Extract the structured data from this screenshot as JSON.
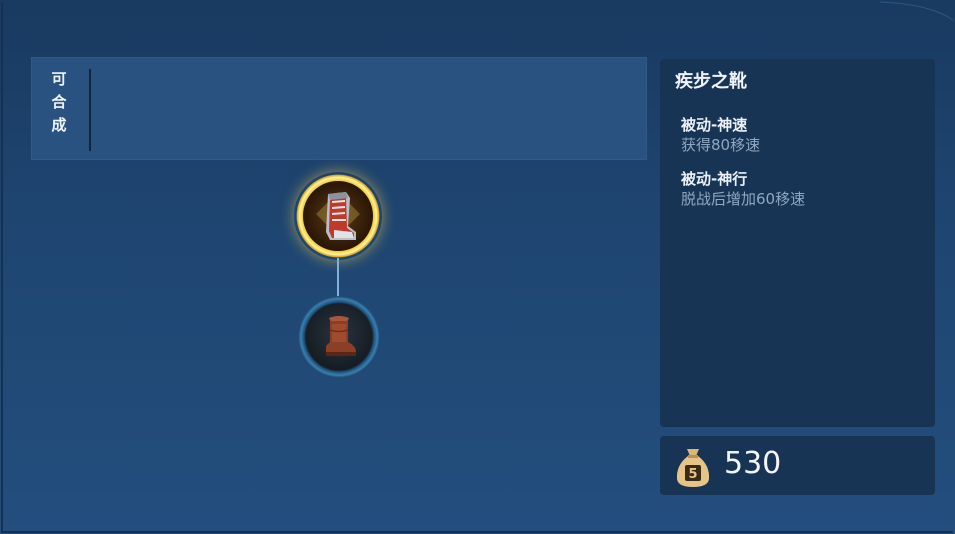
{
  "craftable_panel": {
    "label": "可\n合\n成"
  },
  "recipe_tree": {
    "result_item_icon": "armored-boots-icon",
    "component_item_icon": "leather-boots-icon",
    "highlight_color": "#f6d64a"
  },
  "item_detail": {
    "name": "疾步之靴",
    "effects": [
      {
        "title": "被动-神速",
        "description": "获得80移速"
      },
      {
        "title": "被动-神行",
        "description": "脱战后增加60移速"
      }
    ]
  },
  "price": {
    "icon": "money-bag-icon",
    "value": "530"
  }
}
